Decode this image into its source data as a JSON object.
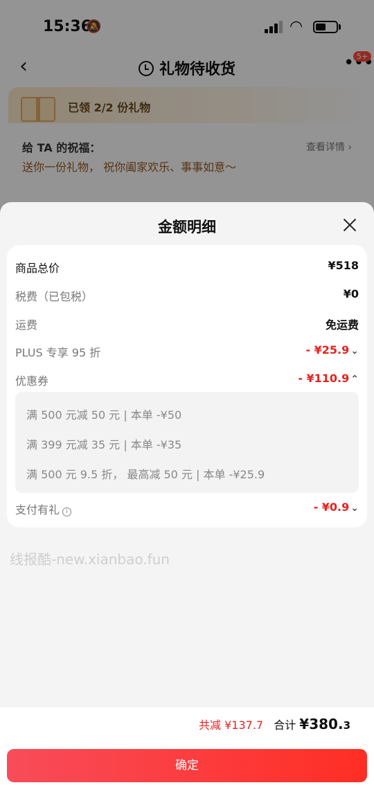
{
  "status_bar": {
    "time": "15:36"
  },
  "nav": {
    "title": "礼物待收货",
    "badge": "5+"
  },
  "gift": {
    "received": "已领 2/2 份礼物",
    "wish_title": "给 TA 的祝福：",
    "wish_detail": "查看详情 ›",
    "wish_text": "送你一份礼物，  祝你阖家欢乐、事事如意～"
  },
  "sheet": {
    "title": "金额明细",
    "rows": [
      {
        "label": "商品总价",
        "value": "¥518"
      },
      {
        "label": "税费（已包税）",
        "value": "¥0"
      },
      {
        "label": "运费",
        "value": "免运费"
      },
      {
        "label": "PLUS 专享 95 折",
        "value": "- ¥25.9"
      },
      {
        "label": "优惠券",
        "value": "- ¥110.9"
      },
      {
        "label": "支付有礼",
        "value": "- ¥0.9"
      }
    ],
    "coupons": [
      "满 500 元减 50 元 | 本单 -¥50",
      "满 399 元减 35 元 | 本单 -¥35",
      "满 500 元 9.5 折，  最高减 50 元 | 本单 -¥25.9"
    ],
    "watermark": "线报酷-new.xianbao.fun"
  },
  "footer": {
    "reduce": "共减 ¥137.7",
    "total_label": "合计",
    "total_main": "¥380.",
    "total_decimal": "3",
    "confirm": "确定"
  },
  "colors": {
    "accent_red": "#e6231f",
    "button_start": "#f84c5a",
    "button_end": "#ff2e24"
  }
}
